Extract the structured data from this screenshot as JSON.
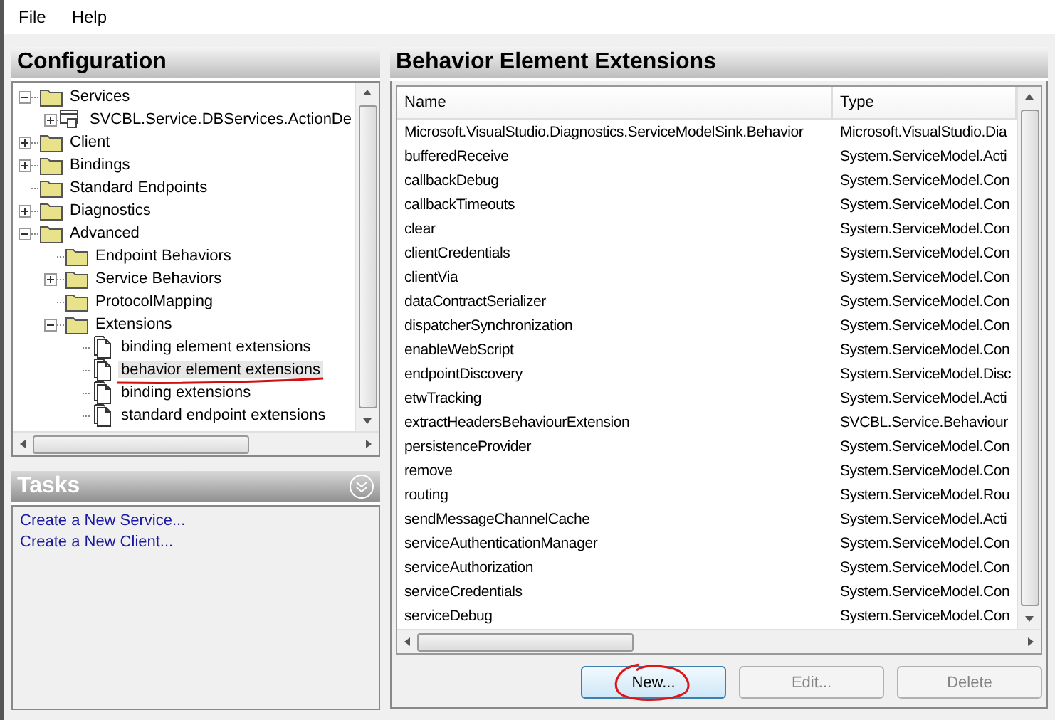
{
  "menu": [
    "File",
    "Help"
  ],
  "configuration": {
    "title": "Configuration",
    "tree": [
      {
        "label": "Services",
        "kind": "folder",
        "expanded": true,
        "selected": false,
        "children": [
          {
            "label": "SVCBL.Service.DBServices.ActionDe",
            "kind": "service",
            "expanded": false,
            "selected": false
          }
        ]
      },
      {
        "label": "Client",
        "kind": "folder",
        "expanded": false,
        "selected": false
      },
      {
        "label": "Bindings",
        "kind": "folder",
        "expanded": false,
        "selected": false
      },
      {
        "label": "Standard Endpoints",
        "kind": "folder",
        "selected": false
      },
      {
        "label": "Diagnostics",
        "kind": "folder",
        "expanded": false,
        "selected": false
      },
      {
        "label": "Advanced",
        "kind": "folder",
        "expanded": true,
        "selected": false,
        "children": [
          {
            "label": "Endpoint Behaviors",
            "kind": "folder",
            "selected": false
          },
          {
            "label": "Service Behaviors",
            "kind": "folder",
            "expanded": false,
            "selected": false
          },
          {
            "label": "ProtocolMapping",
            "kind": "folder",
            "selected": false
          },
          {
            "label": "Extensions",
            "kind": "folder",
            "expanded": true,
            "selected": false,
            "children": [
              {
                "label": "binding element extensions",
                "kind": "document",
                "selected": false
              },
              {
                "label": "behavior element extensions",
                "kind": "document",
                "selected": true,
                "underlined": true
              },
              {
                "label": "binding extensions",
                "kind": "document",
                "selected": false
              },
              {
                "label": "standard endpoint extensions",
                "kind": "document",
                "selected": false
              }
            ]
          }
        ]
      }
    ]
  },
  "tasks": {
    "title": "Tasks",
    "links": [
      "Create a New Service...",
      "Create a New Client..."
    ]
  },
  "extensions": {
    "title": "Behavior Element Extensions",
    "columns": [
      "Name",
      "Type"
    ],
    "rows": [
      [
        "Microsoft.VisualStudio.Diagnostics.ServiceModelSink.Behavior",
        "Microsoft.VisualStudio.Dia"
      ],
      [
        "bufferedReceive",
        "System.ServiceModel.Acti"
      ],
      [
        "callbackDebug",
        "System.ServiceModel.Con"
      ],
      [
        "callbackTimeouts",
        "System.ServiceModel.Con"
      ],
      [
        "clear",
        "System.ServiceModel.Con"
      ],
      [
        "clientCredentials",
        "System.ServiceModel.Con"
      ],
      [
        "clientVia",
        "System.ServiceModel.Con"
      ],
      [
        "dataContractSerializer",
        "System.ServiceModel.Con"
      ],
      [
        "dispatcherSynchronization",
        "System.ServiceModel.Con"
      ],
      [
        "enableWebScript",
        "System.ServiceModel.Con"
      ],
      [
        "endpointDiscovery",
        "System.ServiceModel.Disc"
      ],
      [
        "etwTracking",
        "System.ServiceModel.Acti"
      ],
      [
        "extractHeadersBehaviourExtension",
        "SVCBL.Service.Behaviour"
      ],
      [
        "persistenceProvider",
        "System.ServiceModel.Con"
      ],
      [
        "remove",
        "System.ServiceModel.Con"
      ],
      [
        "routing",
        "System.ServiceModel.Rou"
      ],
      [
        "sendMessageChannelCache",
        "System.ServiceModel.Acti"
      ],
      [
        "serviceAuthenticationManager",
        "System.ServiceModel.Con"
      ],
      [
        "serviceAuthorization",
        "System.ServiceModel.Con"
      ],
      [
        "serviceCredentials",
        "System.ServiceModel.Con"
      ],
      [
        "serviceDebug",
        "System.ServiceModel.Con"
      ]
    ],
    "buttons": [
      {
        "label": "New...",
        "disabled": false,
        "circled": true
      },
      {
        "label": "Edit...",
        "disabled": true
      },
      {
        "label": "Delete",
        "disabled": true
      }
    ]
  }
}
